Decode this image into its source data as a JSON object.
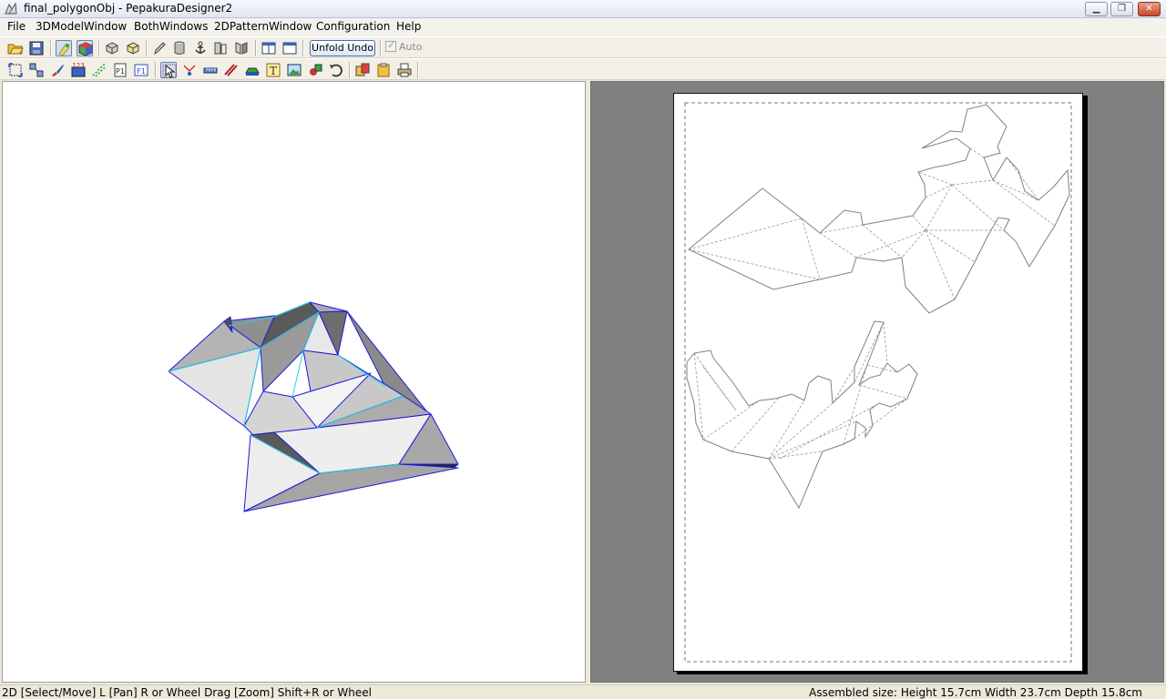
{
  "window": {
    "title": "final_polygonObj - PepakuraDesigner2",
    "minimize": "▁",
    "maximize": "❐",
    "close": "✕"
  },
  "menu": [
    "File",
    "3DModelWindow",
    "BothWindows",
    "2DPatternWindow",
    "Configuration",
    "Help"
  ],
  "toolbar": {
    "unfold_undo": "Unfold Undo",
    "auto_label": "Auto",
    "auto_checked": true
  },
  "status": {
    "left": "2D [Select/Move] L [Pan] R or Wheel Drag [Zoom] Shift+R or Wheel",
    "right": "Assembled size: Height 15.7cm Width 23.7cm Depth 15.8cm"
  },
  "colors": {
    "model_edge": "#1a1adc",
    "model_fold_edge": "#22d6e6",
    "pattern_background": "#808080",
    "pattern_line": "#808080"
  }
}
